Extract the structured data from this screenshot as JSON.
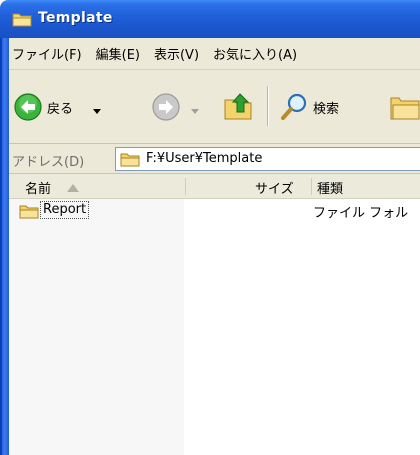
{
  "window": {
    "title": "Template"
  },
  "menu": {
    "items": [
      "ファイル(F)",
      "編集(E)",
      "表示(V)",
      "お気に入り(A)"
    ]
  },
  "toolbar": {
    "back_label": "戻る",
    "search_label": "検索"
  },
  "address": {
    "label": "アドレス(D)",
    "value": "F:¥User¥Template"
  },
  "list": {
    "columns": {
      "name": "名前",
      "size": "サイズ",
      "type": "種類"
    },
    "rows": [
      {
        "name": "Report",
        "size": "",
        "type": "ファイル フォル"
      }
    ]
  },
  "colors": {
    "titlebar": "#1e5fd8",
    "chrome": "#ece9d8",
    "folder": "#f3d36b",
    "back_button": "#2ea02e"
  },
  "icons": [
    "folder-icon",
    "back-arrow-icon",
    "forward-arrow-icon",
    "dropdown-arrow-icon",
    "up-folder-icon",
    "search-icon",
    "folders-icon",
    "sort-ascending-icon"
  ]
}
